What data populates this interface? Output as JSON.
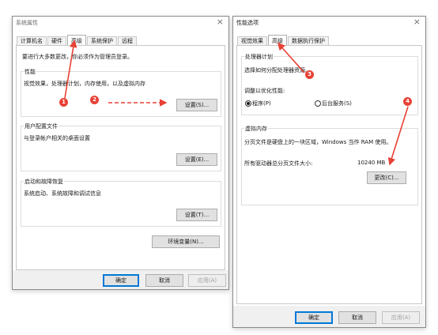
{
  "window1": {
    "title": "系统属性",
    "close_glyph": "×",
    "tabs": [
      "计算机名",
      "硬件",
      "高级",
      "系统保护",
      "远程"
    ],
    "active_tab": 2,
    "admin_note": "要进行大多数更改，你必须作为管理员登录。",
    "performance": {
      "title": "性能",
      "desc": "视觉效果，处理器计划，内存使用，以及虚拟内存",
      "button": "设置(S)..."
    },
    "profiles": {
      "title": "用户配置文件",
      "desc": "与登录帐户相关的桌面设置",
      "button": "设置(E)..."
    },
    "startup": {
      "title": "启动和故障恢复",
      "desc": "系统启动、系统故障和调试信息",
      "button": "设置(T)..."
    },
    "env_button": "环境变量(N)...",
    "ok": "确定",
    "cancel": "取消",
    "apply": "应用(A)"
  },
  "window2": {
    "title": "性能选项",
    "close_glyph": "×",
    "tabs": [
      "视觉效果",
      "高级",
      "数据执行保护"
    ],
    "active_tab": 1,
    "processor": {
      "title": "处理器计划",
      "desc": "选择如何分配处理器资源。",
      "adjust_label": "调整以优化性能:",
      "option_programs": "程序(P)",
      "option_services": "后台服务(S)",
      "selected": "程序(P)"
    },
    "vm": {
      "title": "虚拟内存",
      "desc": "分页文件是硬盘上的一块区域，Windows 当作 RAM 使用。",
      "total_label": "所有驱动器总分页文件大小:",
      "total_value": "10240 MB",
      "button": "更改(C)..."
    },
    "ok": "确定",
    "cancel": "取消",
    "apply": "应用(A)"
  },
  "annotations": {
    "color": "#e84135",
    "badges": [
      "1",
      "2",
      "3",
      "4"
    ]
  }
}
